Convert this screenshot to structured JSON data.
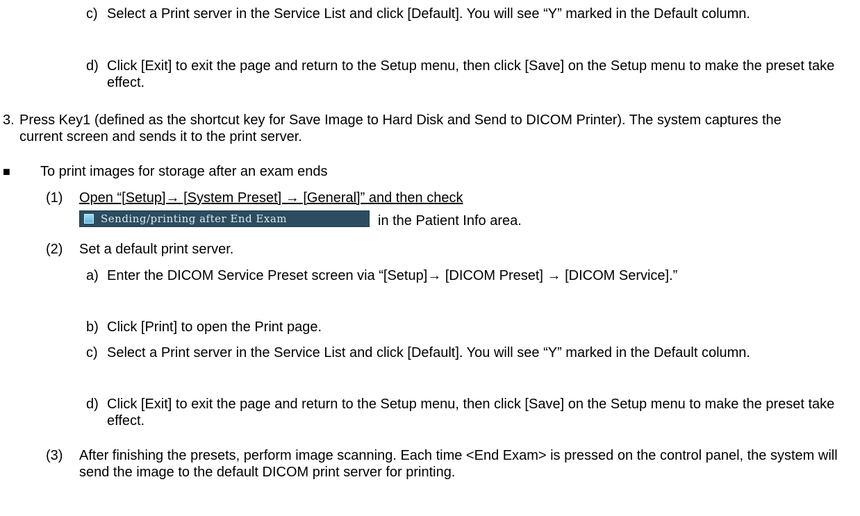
{
  "items": [
    {
      "marker": "c)",
      "text": "Select a Print server in the Service List and click [Default]. You will see “Y” marked in the Default column."
    },
    {
      "marker": "d)",
      "text": "Click [Exit] to exit the page and return to the Setup menu, then click [Save] on the Setup menu to make the preset take effect."
    },
    {
      "marker": "3.",
      "text": "Press Key1 (defined as the shortcut key for Save Image to Hard Disk and Send to DICOM Printer). The system captures the current screen and sends it to the print server."
    },
    {
      "marker": "■",
      "text": "To print images for storage after an exam ends"
    },
    {
      "marker": "(1)",
      "text_before": "Open “[Setup]→ [System Preset] → [General]” and then check",
      "checkbox_label": "Sending/printing after End Exam",
      "text_after": "in the Patient Info area."
    },
    {
      "marker": "(2)",
      "text": "Set a default print server."
    },
    {
      "marker": "a)",
      "text": "Enter the DICOM Service Preset screen via “[Setup]→ [DICOM Preset] → [DICOM Service].”"
    },
    {
      "marker": "b)",
      "text": "Click [Print] to open the Print page."
    },
    {
      "marker": "c)",
      "text": "Select a Print server in the Service List and click [Default]. You will see “Y” marked in the Default column."
    },
    {
      "marker": "d)",
      "text": "Click [Exit] to exit the page and return to the Setup menu, then click [Save] on the Setup menu to make the preset take effect."
    },
    {
      "marker": "(3)",
      "text": "After finishing the presets, perform image scanning. Each time <End Exam> is pressed on the control panel, the system will send the image to the default DICOM print server for printing."
    }
  ]
}
